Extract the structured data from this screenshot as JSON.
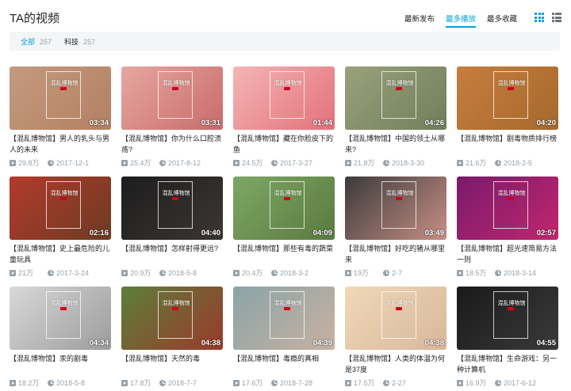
{
  "header": {
    "title": "TA的视频",
    "sorts": [
      {
        "label": "最新发布",
        "active": false
      },
      {
        "label": "最多播放",
        "active": true
      },
      {
        "label": "最多收藏",
        "active": false
      }
    ]
  },
  "filters": [
    {
      "label": "全部",
      "count": "257",
      "active": true
    },
    {
      "label": "科技",
      "count": "257",
      "active": false
    }
  ],
  "videos": [
    {
      "title": "【混乱博物馆】男人的乳头与男人的未来",
      "duration": "03:34",
      "plays": "29.8万",
      "date": "2017-12-1",
      "colors": [
        "#c49a7e",
        "#b38063"
      ],
      "overlay": "混乱博物馆"
    },
    {
      "title": "【混乱博物馆】你为什么口腔溃疡?",
      "duration": "03:31",
      "plays": "25.4万",
      "date": "2017-8-12",
      "colors": [
        "#e6a7a1",
        "#c96b6a"
      ],
      "overlay": "混乱博物馆"
    },
    {
      "title": "【混乱博物馆】藏在你脸皮下的鱼",
      "duration": "01:44",
      "plays": "24.5万",
      "date": "2017-3-27",
      "colors": [
        "#f2b6b4",
        "#e5707a"
      ],
      "overlay": "混乱博物馆"
    },
    {
      "title": "【混乱博物馆】中国的领土从哪来?",
      "duration": "04:26",
      "plays": "21.8万",
      "date": "2018-3-30",
      "colors": [
        "#9aa17c",
        "#6f7f5a"
      ],
      "overlay": "混乱博物馆"
    },
    {
      "title": "【混乱博物馆】剧毒物质排行榜",
      "duration": "04:20",
      "plays": "21.6万",
      "date": "2018-2-5",
      "colors": [
        "#c77d3e",
        "#a5692c"
      ],
      "overlay": "混乱博物馆"
    },
    {
      "title": "【混乱博物馆】史上最危险的儿童玩具",
      "duration": "02:16",
      "plays": "21万",
      "date": "2017-3-24",
      "colors": [
        "#b33a2c",
        "#6c3b22"
      ],
      "overlay": "混乱博物馆"
    },
    {
      "title": "【混乱博物馆】怎样射得更远?",
      "duration": "04:40",
      "plays": "20.9万",
      "date": "2018-5-8",
      "colors": [
        "#1d1d1d",
        "#3c3633"
      ],
      "overlay": "混乱博物馆"
    },
    {
      "title": "【混乱博物馆】那些有毒的蔬菜",
      "duration": "04:09",
      "plays": "20.4万",
      "date": "2018-3-2",
      "colors": [
        "#7da764",
        "#5b7a3f"
      ],
      "overlay": "混乱博物馆"
    },
    {
      "title": "【混乱博物馆】好吃的猪从哪里来",
      "duration": "03:49",
      "plays": "19万",
      "date": "2-7",
      "colors": [
        "#3b3b3b",
        "#c88f85"
      ],
      "overlay": "混乱博物馆"
    },
    {
      "title": "【混乱博物馆】超光速简易方法一则",
      "duration": "02:57",
      "plays": "18.5万",
      "date": "2018-3-14",
      "colors": [
        "#7a1a6b",
        "#c0276e"
      ],
      "overlay": "混乱博物馆"
    },
    {
      "title": "【混乱博物馆】汞的剧毒",
      "duration": "04:34",
      "plays": "18.2万",
      "date": "2018-5-8",
      "colors": [
        "#d8d8d8",
        "#9c9c9c"
      ],
      "overlay": "混乱博物馆"
    },
    {
      "title": "【混乱博物馆】天然的毒",
      "duration": "04:38",
      "plays": "17.8万",
      "date": "2018-7-7",
      "colors": [
        "#5c7e3a",
        "#9a3a2b"
      ],
      "overlay": "混乱博物馆"
    },
    {
      "title": "【混乱博物馆】毒瘾的真相",
      "duration": "04:39",
      "plays": "17.6万",
      "date": "2018-7-28",
      "colors": [
        "#8aa4a8",
        "#c9b1a0"
      ],
      "overlay": "混乱博物馆"
    },
    {
      "title": "【混乱博物馆】人类的体温为何是37度",
      "duration": "04:38",
      "plays": "17.5万",
      "date": "2-27",
      "colors": [
        "#f0d9b8",
        "#d8b79a"
      ],
      "overlay": "混乱博物馆"
    },
    {
      "title": "【混乱博物馆】生命游戏：另一种计算机",
      "duration": "04:55",
      "plays": "16.9万",
      "date": "2017-6-12",
      "colors": [
        "#1a1a1a",
        "#3a3a3a"
      ],
      "overlay": "混乱博物馆"
    }
  ]
}
